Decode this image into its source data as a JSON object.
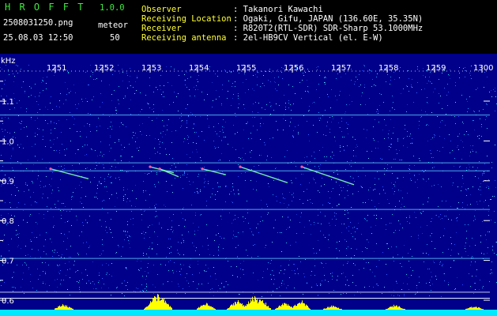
{
  "header": {
    "app_name": "H R O F F T",
    "version": "1.0.0",
    "filename": "2508031250.png",
    "meteor_label": "meteor",
    "datetime": "25.08.03 12:50",
    "meteor_count": "50",
    "info": [
      {
        "label": "Observer",
        "value": ": Takanori Kawachi"
      },
      {
        "label": "Receiving Location",
        "value": ": Ogaki, Gifu, JAPAN (136.60E, 35.35N)"
      },
      {
        "label": "Receiver",
        "value": ": R820T2(RTL-SDR) SDR-Sharp 53.1000MHz"
      },
      {
        "label": "Receiving antenna",
        "value": ": 2el-HB9CV Vertical (el. E-W)"
      }
    ]
  },
  "axes": {
    "y_unit": "kHz",
    "time_ticks": [
      "1251",
      "1252",
      "1253",
      "1254",
      "1255",
      "1256",
      "1257",
      "1258",
      "1259",
      "1300"
    ],
    "freq_ticks": [
      {
        "label": "1.1",
        "value": 1.1
      },
      {
        "label": "1.0",
        "value": 1.0
      },
      {
        "label": "0.9",
        "value": 0.9
      },
      {
        "label": "0.8",
        "value": 0.8
      },
      {
        "label": "0.7",
        "value": 0.7
      },
      {
        "label": "0.6",
        "value": 0.6
      }
    ]
  },
  "carrier_lines_khz": [
    1.065,
    0.945,
    0.925,
    0.828,
    0.705,
    0.62
  ],
  "meteor_echoes": [
    {
      "t_start": 1250.9,
      "t_end": 1251.7,
      "f_start": 0.93,
      "f_end": 0.905
    },
    {
      "t_start": 1253.0,
      "t_end": 1253.5,
      "f_start": 0.935,
      "f_end": 0.92
    },
    {
      "t_start": 1253.2,
      "t_end": 1253.6,
      "f_start": 0.93,
      "f_end": 0.91
    },
    {
      "t_start": 1254.1,
      "t_end": 1254.6,
      "f_start": 0.93,
      "f_end": 0.915
    },
    {
      "t_start": 1254.9,
      "t_end": 1255.9,
      "f_start": 0.935,
      "f_end": 0.895
    },
    {
      "t_start": 1256.2,
      "t_end": 1257.3,
      "f_start": 0.935,
      "f_end": 0.89
    }
  ],
  "colors": {
    "accent_green": "#3ee83e",
    "label_yellow": "#ffff33",
    "text_white": "#ffffff",
    "background_blue": "#00008a",
    "histogram_cyan": "#00e8ff",
    "histogram_yellow": "#ffff00"
  }
}
